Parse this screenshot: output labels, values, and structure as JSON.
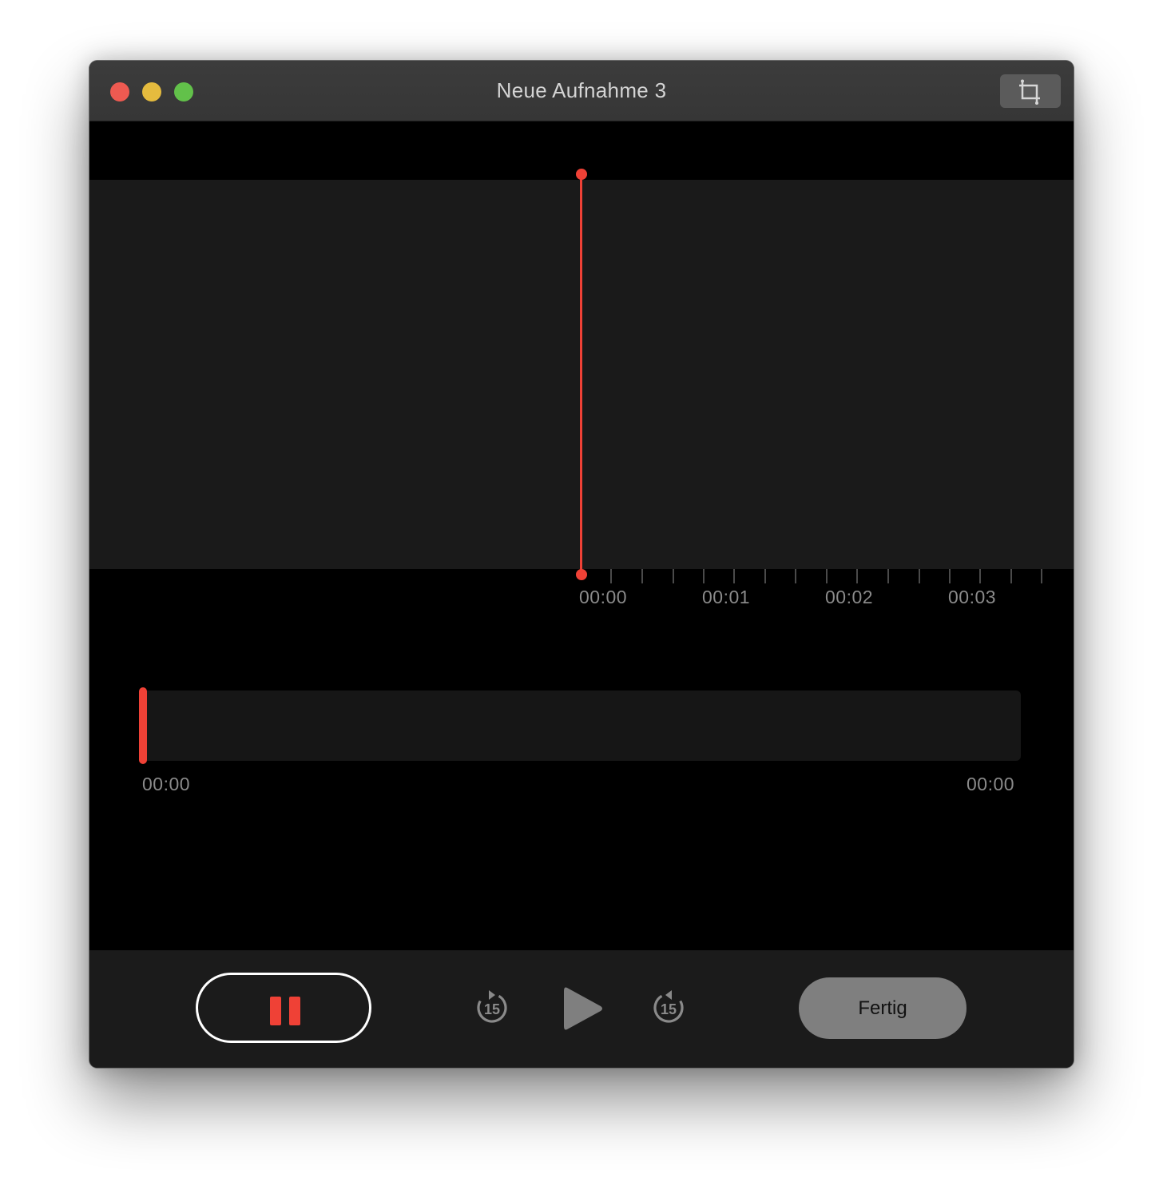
{
  "window": {
    "title": "Neue Aufnahme 3"
  },
  "titlebar": {
    "traffic_lights": [
      {
        "name": "close",
        "color": "#ee5a51"
      },
      {
        "name": "minimize",
        "color": "#e5bb3e"
      },
      {
        "name": "zoom",
        "color": "#62c14a"
      }
    ],
    "trim_icon": "crop-icon"
  },
  "timeline": {
    "labels": [
      "00:00",
      "00:01",
      "00:02",
      "00:03"
    ]
  },
  "overview": {
    "start_time": "00:00",
    "end_time": "00:00"
  },
  "controls": {
    "pause_icon": "pause-icon",
    "skip_back_icon": "skip-back-15-icon",
    "skip_back_seconds": "15",
    "play_icon": "play-icon",
    "skip_forward_icon": "skip-forward-15-icon",
    "skip_forward_seconds": "15",
    "done_label": "Fertig"
  },
  "colors": {
    "accent": "#ef4136",
    "background": "#000000",
    "panel": "#1a1a1a"
  }
}
